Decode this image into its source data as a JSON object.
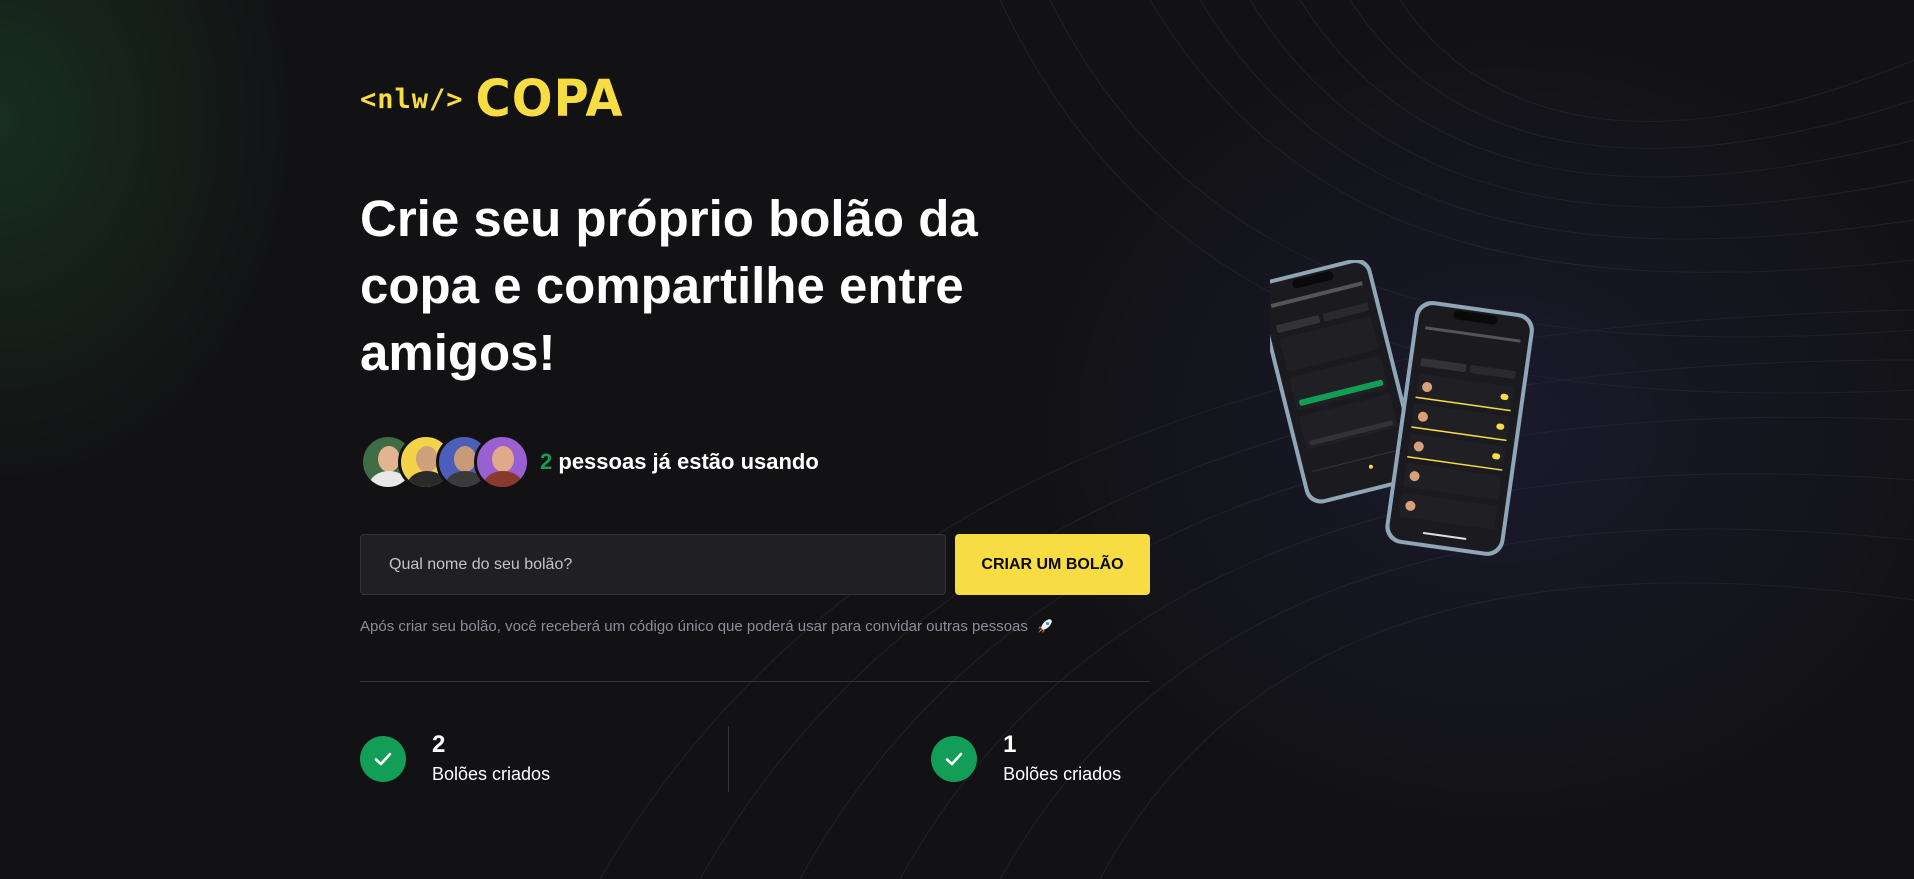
{
  "brand": {
    "tag": "<nlw/>",
    "name": "COPA"
  },
  "headline": "Crie seu próprio bolão da copa e compartilhe entre amigos!",
  "users": {
    "count": "2",
    "text": "pessoas já estão usando"
  },
  "form": {
    "placeholder": "Qual nome do seu bolão?",
    "button_label": "CRIAR UM BOLÃO"
  },
  "hint": "Após criar seu bolão, você receberá um código único que poderá usar para convidar outras pessoas",
  "stats": [
    {
      "value": "2",
      "label": "Bolões criados"
    },
    {
      "value": "1",
      "label": "Bolões criados"
    }
  ],
  "colors": {
    "accent": "#F7DD43",
    "green": "#129E57",
    "background": "#121214",
    "input_bg": "#202024"
  }
}
